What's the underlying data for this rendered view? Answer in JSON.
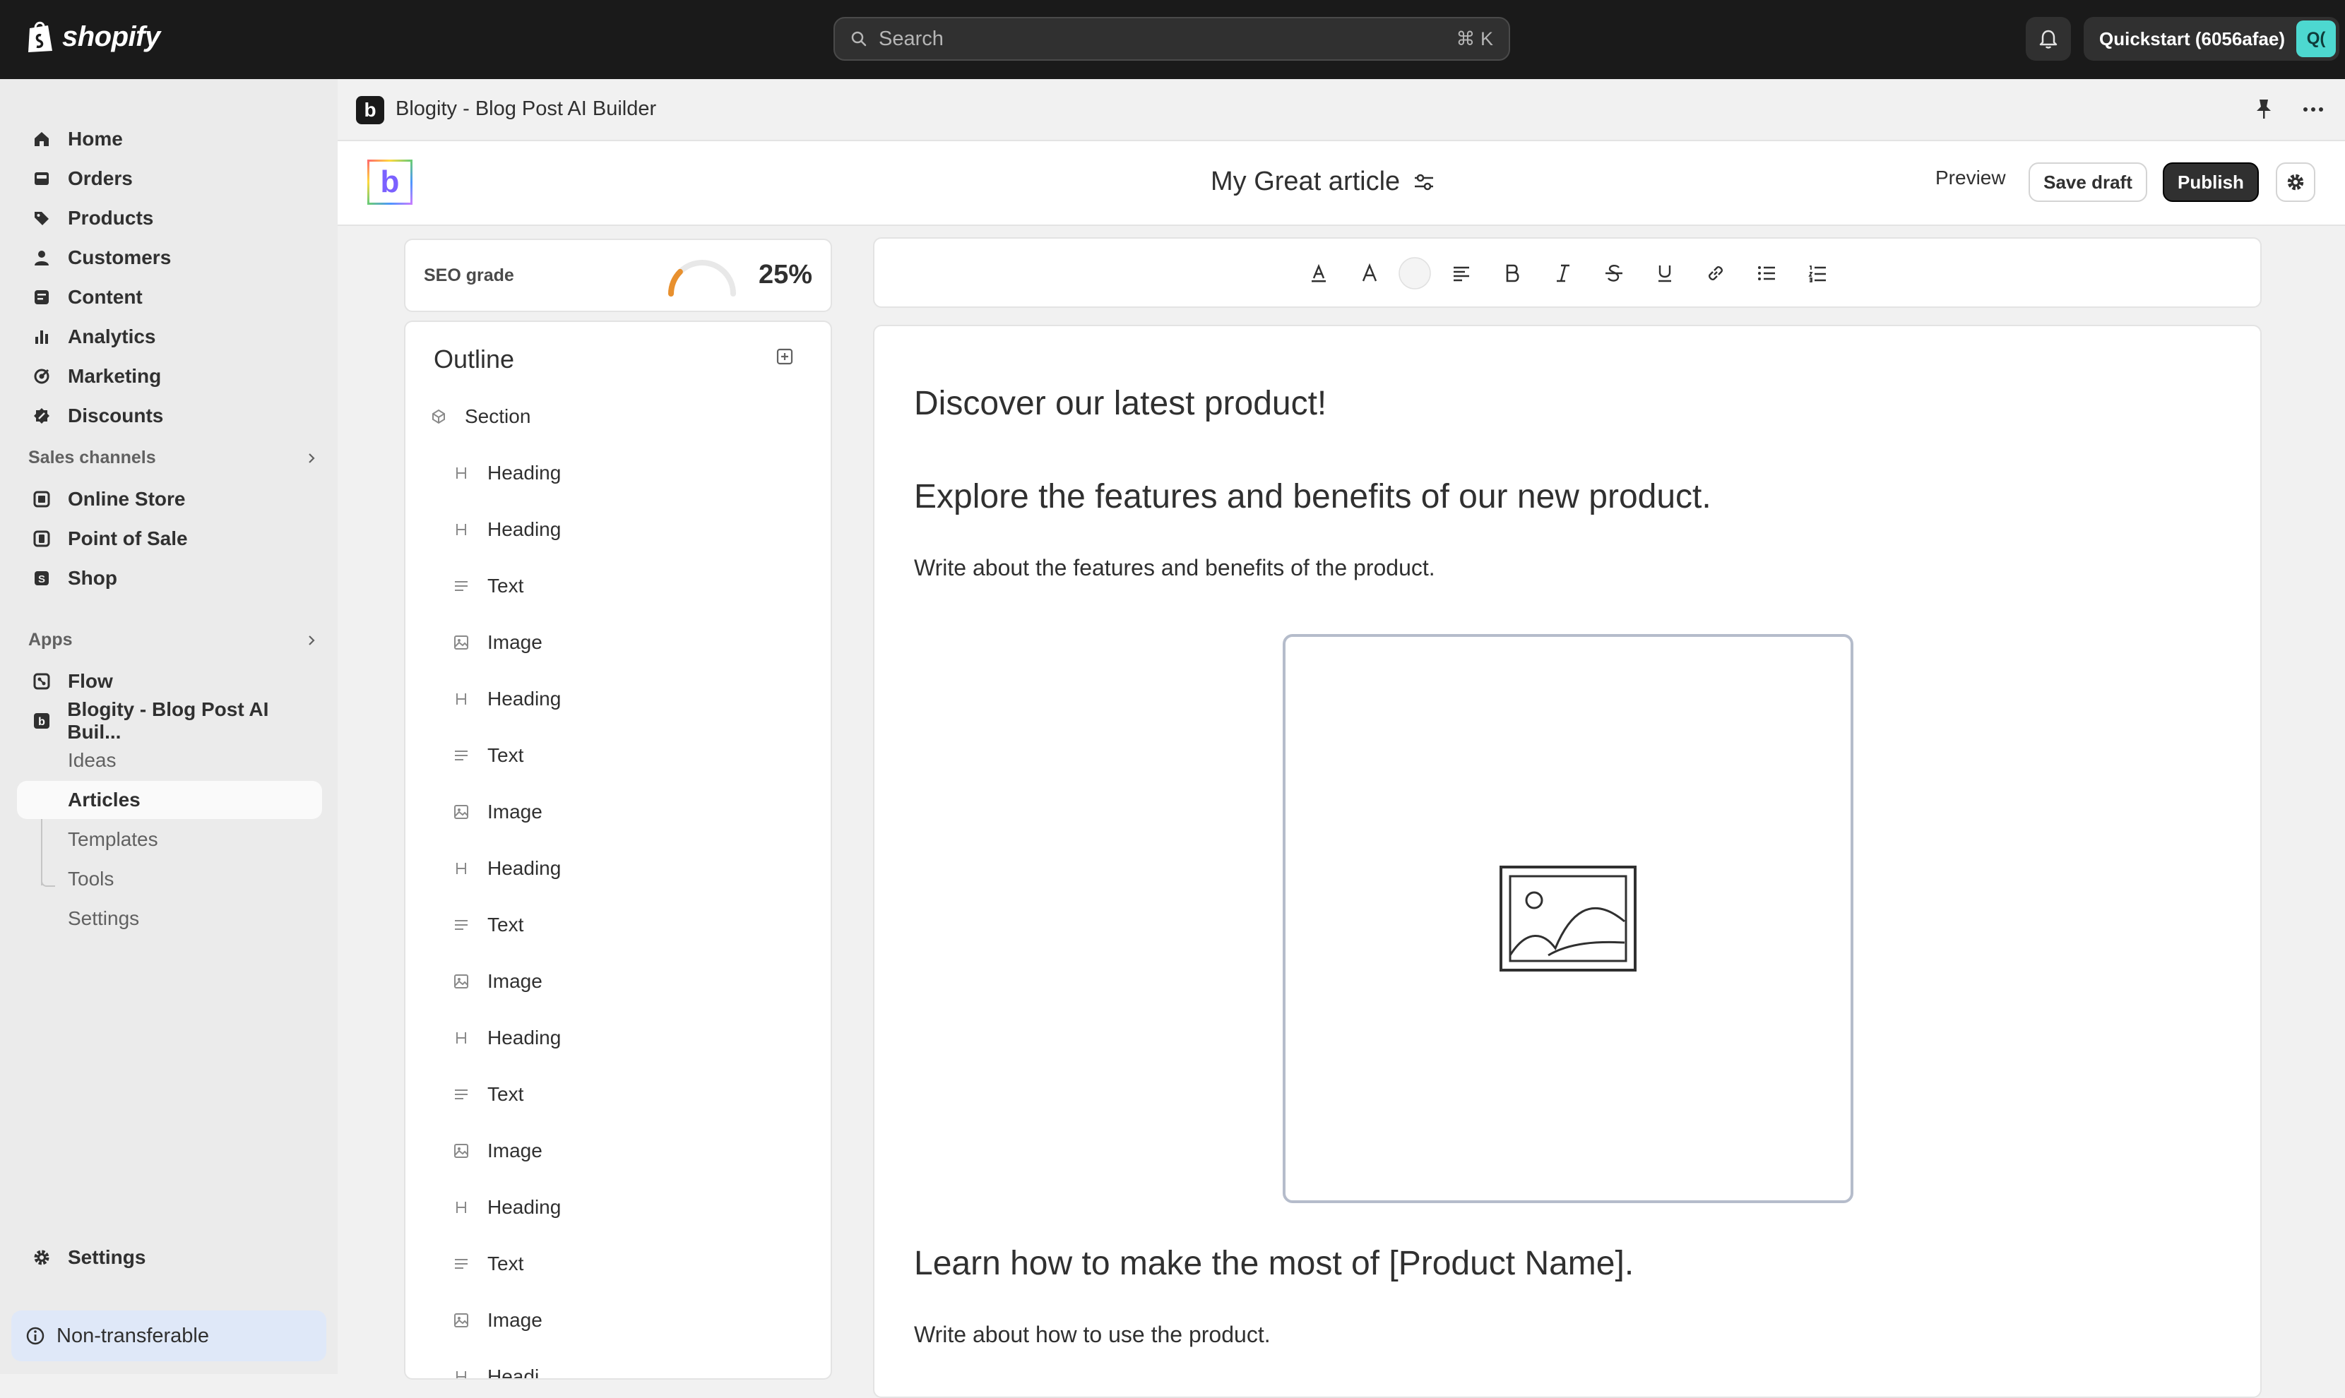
{
  "topbar": {
    "brand": "shopify",
    "search_placeholder": "Search",
    "search_shortcut": "⌘ K",
    "store_name": "Quickstart (6056afae)",
    "store_avatar": "Q("
  },
  "sidebar": {
    "main": [
      {
        "label": "Home",
        "icon": "home-icon"
      },
      {
        "label": "Orders",
        "icon": "orders-icon"
      },
      {
        "label": "Products",
        "icon": "tag-icon"
      },
      {
        "label": "Customers",
        "icon": "person-icon"
      },
      {
        "label": "Content",
        "icon": "content-icon"
      },
      {
        "label": "Analytics",
        "icon": "analytics-icon"
      },
      {
        "label": "Marketing",
        "icon": "marketing-icon"
      },
      {
        "label": "Discounts",
        "icon": "discount-icon"
      }
    ],
    "sales_channels_label": "Sales channels",
    "sales_channels": [
      {
        "label": "Online Store",
        "icon": "store-icon"
      },
      {
        "label": "Point of Sale",
        "icon": "pos-icon"
      },
      {
        "label": "Shop",
        "icon": "shop-icon"
      }
    ],
    "apps_label": "Apps",
    "apps": [
      {
        "label": "Flow",
        "icon": "flow-icon"
      },
      {
        "label": "Blogity - Blog Post AI Buil...",
        "icon": "blogity-icon"
      }
    ],
    "app_subitems": [
      "Ideas",
      "Articles",
      "Templates",
      "Tools",
      "Settings"
    ],
    "active_subitem": "Articles",
    "settings_label": "Settings",
    "notice": "Non-transferable"
  },
  "app_header": {
    "icon_letter": "b",
    "title": "Blogity - Blog Post AI Builder"
  },
  "editor": {
    "logo_letter": "b",
    "title": "My Great article",
    "preview_label": "Preview",
    "save_label": "Save draft",
    "publish_label": "Publish"
  },
  "seo": {
    "label": "SEO grade",
    "value": "25%",
    "grade_fraction": 0.25
  },
  "outline": {
    "title": "Outline",
    "items": [
      {
        "type": "section",
        "label": "Section"
      },
      {
        "type": "heading",
        "label": "Heading"
      },
      {
        "type": "heading",
        "label": "Heading"
      },
      {
        "type": "text",
        "label": "Text"
      },
      {
        "type": "image",
        "label": "Image"
      },
      {
        "type": "heading",
        "label": "Heading"
      },
      {
        "type": "text",
        "label": "Text"
      },
      {
        "type": "image",
        "label": "Image"
      },
      {
        "type": "heading",
        "label": "Heading"
      },
      {
        "type": "text",
        "label": "Text"
      },
      {
        "type": "image",
        "label": "Image"
      },
      {
        "type": "heading",
        "label": "Heading"
      },
      {
        "type": "text",
        "label": "Text"
      },
      {
        "type": "image",
        "label": "Image"
      },
      {
        "type": "heading",
        "label": "Heading"
      },
      {
        "type": "text",
        "label": "Text"
      },
      {
        "type": "image",
        "label": "Image"
      },
      {
        "type": "heading",
        "label": "Headi"
      }
    ]
  },
  "toolbar": [
    "text-color",
    "font",
    "highlight",
    "align",
    "bold",
    "italic",
    "strikethrough",
    "underline",
    "link",
    "bullet-list",
    "numbered-list"
  ],
  "content": {
    "h1": "Discover our latest product!",
    "h2": "Explore the features and benefits of our new product.",
    "p1": "Write about the features and benefits of the product.",
    "h3": "Learn how to make the most of [Product Name].",
    "p2": "Write about how to use the product."
  },
  "colors": {
    "topbar": "#1a1a1a",
    "sidebar": "#ebebeb",
    "accent_avatar": "#4dd8d0",
    "seo_gauge": "#e8902e",
    "notice_bg": "#dfe8f8"
  }
}
